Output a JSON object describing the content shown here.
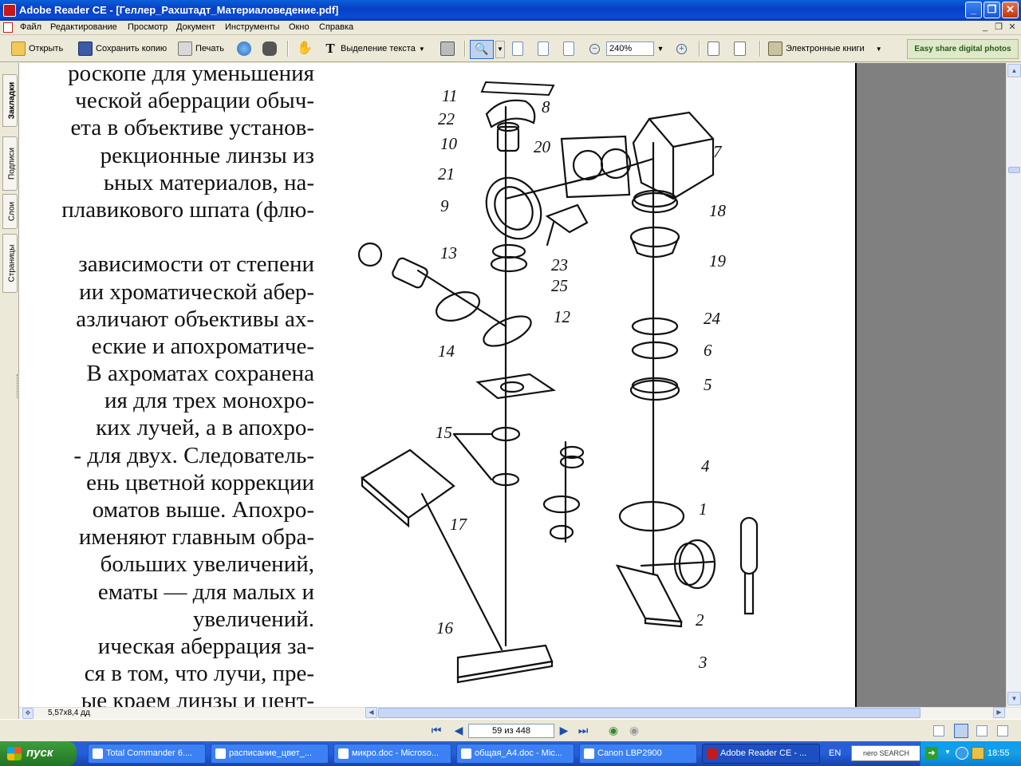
{
  "window": {
    "title": "Adobe Reader CE - [Геллер_Рахштадт_Материаловедение.pdf]"
  },
  "menu": [
    "Файл",
    "Редактирование",
    "Просмотр",
    "Документ",
    "Инструменты",
    "Окно",
    "Справка"
  ],
  "toolbar": {
    "open": "Открыть",
    "save_copy": "Сохранить копию",
    "print": "Печать",
    "select_text": "Выделение текста",
    "zoom_value": "240%",
    "ebooks": "Электронные книги",
    "easy_share": "Easy share digital photos"
  },
  "nav_tabs": [
    "Закладки",
    "Подписи",
    "Слои",
    "Страницы"
  ],
  "page_text": [
    "роскопе для уменьшения",
    "ческой аберрации обыч-",
    "ета в объективе установ-",
    "рекционные линзы из",
    "ьных материалов, на-",
    "плавикового шпата (флю-",
    "",
    "зависимости от степени",
    "ии хроматической абер-",
    "азличают объективы ах-",
    "еские и апохроматиче-",
    "В ахроматах сохранена",
    "ия для трех монохро-",
    "ких лучей, а в апохро-",
    "- для двух. Следователь-",
    "ень цветной коррекции",
    "оматов выше. Апохро-",
    "именяют главным обра-",
    "больших увеличений,",
    "ематы — для малых и",
    "увеличений.",
    "ическая аберрация за-",
    "ся в том, что лучи, пре-",
    "ые краем линзы и цент-"
  ],
  "figure_labels": [
    "11",
    "22",
    "8",
    "10",
    "20",
    "7",
    "21",
    "9",
    "18",
    "19",
    "13",
    "23",
    "25",
    "12",
    "24",
    "14",
    "6",
    "5",
    "15",
    "4",
    "1",
    "17",
    "2",
    "16",
    "3"
  ],
  "status": {
    "page_size": "5,57x8,4 дд",
    "page_indicator": "59 из 448"
  },
  "taskbar": {
    "start": "пуск",
    "tasks": [
      "Total Commander 6....",
      "расписание_цвет_...",
      "микро.doc - Microso...",
      "общая_A4.doc - Mic...",
      "Canon LBP2900",
      "Adobe Reader CE - ..."
    ],
    "lang": "EN",
    "search": "nero SEARCH",
    "clock": "18:55"
  }
}
